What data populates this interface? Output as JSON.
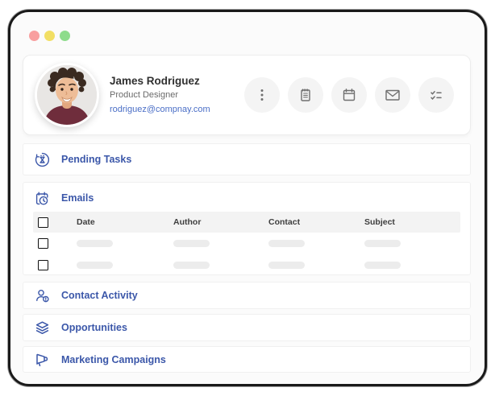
{
  "window": {
    "traffic_lights": {
      "close_color": "#f89f9f",
      "minimize_color": "#f2df64",
      "maximize_color": "#8edc8c"
    }
  },
  "profile": {
    "name": "James Rodriguez",
    "role": "Product Designer",
    "email": "rodriguez@compnay.com"
  },
  "actions": {
    "icons": [
      "kebab-menu",
      "notepad",
      "calendar",
      "envelope",
      "checklist"
    ]
  },
  "sections": {
    "pending_tasks": {
      "label": "Pending Tasks",
      "icon": "hourglass-pending"
    },
    "emails": {
      "label": "Emails",
      "icon": "schedule-clock",
      "table": {
        "headers": [
          "Date",
          "Author",
          "Contact",
          "Subject"
        ],
        "rows": [
          {
            "placeholder": true
          },
          {
            "placeholder": true
          }
        ]
      }
    },
    "contact_activity": {
      "label": "Contact Activity",
      "icon": "person-alert"
    },
    "opportunities": {
      "label": "Opportunities",
      "icon": "layers"
    },
    "marketing_campaigns": {
      "label": "Marketing Campaigns",
      "icon": "megaphone"
    }
  },
  "colors": {
    "accent_blue": "#3b57a9",
    "link_blue": "#4a6ec6",
    "table_header_bg": "#f3f3f3",
    "placeholder_bar": "#ececec",
    "icon_gray": "#6f6f6f"
  }
}
